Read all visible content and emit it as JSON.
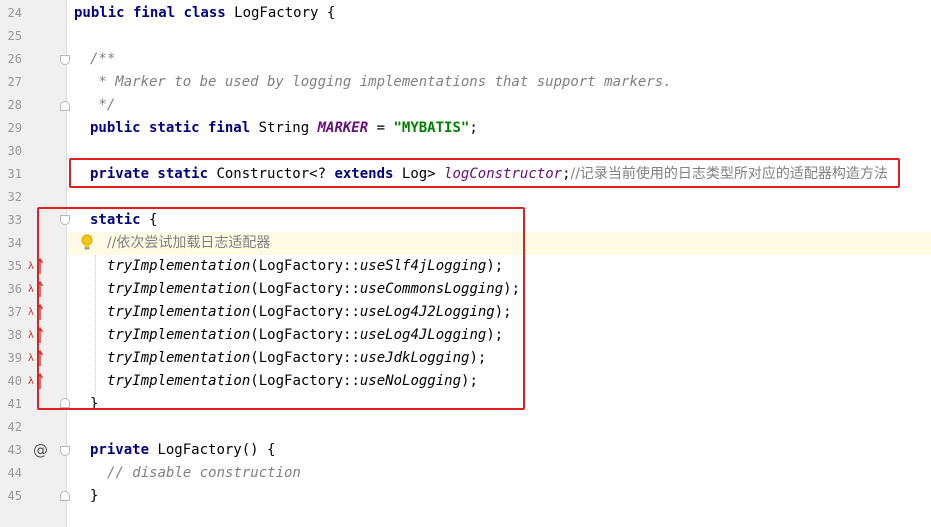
{
  "line_numbers": [
    "24",
    "25",
    "26",
    "27",
    "28",
    "29",
    "30",
    "31",
    "32",
    "33",
    "34",
    "35",
    "36",
    "37",
    "38",
    "39",
    "40",
    "41",
    "42",
    "43",
    "44",
    "45"
  ],
  "code": {
    "l24": {
      "kw": "public final class",
      "rest": " LogFactory {"
    },
    "l26": "/**",
    "l27": " * Marker to be used by logging implementations that support markers.",
    "l28": " */",
    "l29": {
      "kw": "public static final",
      "type": " String ",
      "field": "MARKER",
      "eq": " = ",
      "str": "\"MYBATIS\"",
      "end": ";"
    },
    "l31": {
      "kw1": "private static",
      "type": " Constructor<? ",
      "kw2": "extends",
      "type2": " Log> ",
      "field": "logConstructor",
      "semi": ";",
      "comment": "//记录当前使用的日志类型所对应的适配器构造方法"
    },
    "l33": {
      "kw": "static",
      "rest": " {"
    },
    "l34": "//依次尝试加载日志适配器",
    "calls": [
      {
        "fn": "tryImplementation",
        "open": "(LogFactory::",
        "ref": "useSlf4jLogging",
        "close": ");"
      },
      {
        "fn": "tryImplementation",
        "open": "(LogFactory::",
        "ref": "useCommonsLogging",
        "close": ");"
      },
      {
        "fn": "tryImplementation",
        "open": "(LogFactory::",
        "ref": "useLog4J2Logging",
        "close": ");"
      },
      {
        "fn": "tryImplementation",
        "open": "(LogFactory::",
        "ref": "useLog4JLogging",
        "close": ");"
      },
      {
        "fn": "tryImplementation",
        "open": "(LogFactory::",
        "ref": "useJdkLogging",
        "close": ");"
      },
      {
        "fn": "tryImplementation",
        "open": "(LogFactory::",
        "ref": "useNoLogging",
        "close": ");"
      }
    ],
    "l41": "}",
    "l43": {
      "kw": "private",
      "rest": " LogFactory() {"
    },
    "l44": "// disable construction",
    "l45": "}"
  },
  "gutter_icons": {
    "at": "@",
    "lambda": "λ",
    "bulb": "intention-bulb-icon"
  },
  "colors": {
    "highlight_box": "#e02020",
    "keyword": "#000080",
    "string": "#008000",
    "field": "#660e7a"
  }
}
